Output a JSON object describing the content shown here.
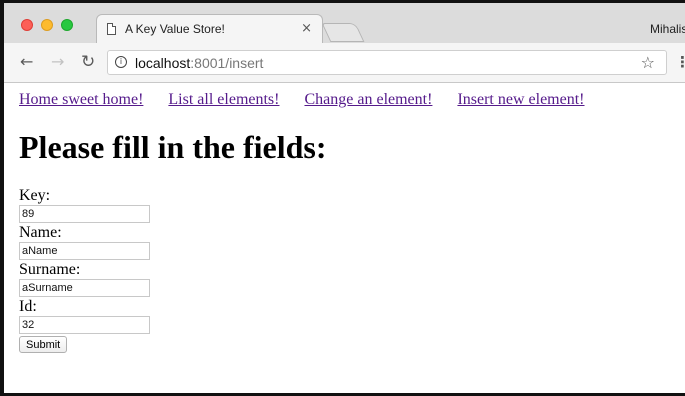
{
  "browser": {
    "tab_title": "A Key Value Store!",
    "tab_close": "×",
    "profile_name": "Mihalis",
    "url_host": "localhost",
    "url_rest": ":8001/insert",
    "icons": {
      "document": "document-icon",
      "close": "close-icon",
      "back": "back-arrow-icon",
      "forward": "forward-arrow-icon",
      "reload": "reload-icon",
      "info": "info-icon",
      "star": "star-icon",
      "menu": "menu-icon"
    }
  },
  "nav": {
    "links": [
      {
        "label": "Home sweet home!"
      },
      {
        "label": "List all elements!"
      },
      {
        "label": "Change an element!"
      },
      {
        "label": "Insert new element!"
      }
    ]
  },
  "page": {
    "heading": "Please fill in the fields:"
  },
  "form": {
    "fields": [
      {
        "label": "Key:",
        "value": "89"
      },
      {
        "label": "Name:",
        "value": "aName"
      },
      {
        "label": "Surname:",
        "value": "aSurname"
      },
      {
        "label": "Id:",
        "value": "32"
      }
    ],
    "submit_label": "Submit"
  }
}
